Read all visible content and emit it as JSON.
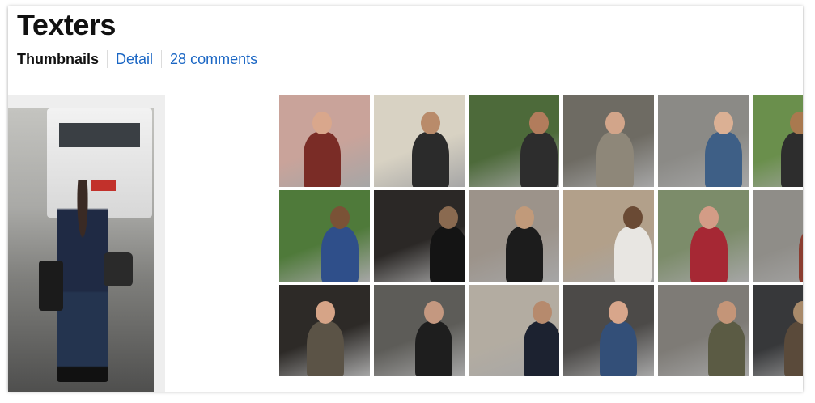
{
  "page": {
    "title": "Texters"
  },
  "tabs": [
    {
      "label": "Thumbnails",
      "active": true
    },
    {
      "label": "Detail",
      "active": false
    },
    {
      "label": "28 comments",
      "active": false
    }
  ],
  "colors": {
    "link": "#1a66c4",
    "sidebar_bg": "#eeeeee",
    "title": "#111111"
  },
  "featured_photo": {
    "subject": "woman-texting-on-sidewalk"
  },
  "thumbnails": [
    {
      "subject": "woman-red-hair-sunglasses",
      "bg": "#c9a39a",
      "accent": "#7a2c26",
      "skin": "#d9a78c"
    },
    {
      "subject": "man-sitting-on-beach",
      "bg": "#d8d2c3",
      "accent": "#2b2b2b",
      "skin": "#b98b6a"
    },
    {
      "subject": "man-in-suit-with-phone",
      "bg": "#4d6a3a",
      "accent": "#2d2d2d",
      "skin": "#b27c5c"
    },
    {
      "subject": "woman-near-food-cart",
      "bg": "#6e6b63",
      "accent": "#8e8779",
      "skin": "#d2a58a"
    },
    {
      "subject": "blonde-woman-on-street",
      "bg": "#8b8a86",
      "accent": "#3e5f86",
      "skin": "#dbb094"
    },
    {
      "subject": "man-at-park-cropped",
      "bg": "#6a8f4c",
      "accent": "#2d2d2d",
      "skin": "#a9794f"
    },
    {
      "subject": "man-under-lamppost-in-park",
      "bg": "#4f7a3a",
      "accent": "#2f4f8a",
      "skin": "#7a5236"
    },
    {
      "subject": "figure-in-dark-hallway",
      "bg": "#2b2826",
      "accent": "#141414",
      "skin": "#8a6a50"
    },
    {
      "subject": "man-sitting-on-chair",
      "bg": "#9c938a",
      "accent": "#1c1c1c",
      "skin": "#c19a7a"
    },
    {
      "subject": "man-with-hat-in-crowd",
      "bg": "#b2a08a",
      "accent": "#e8e6e2",
      "skin": "#6a4a34"
    },
    {
      "subject": "man-at-cafe-table",
      "bg": "#7c8c6a",
      "accent": "#a62834",
      "skin": "#d39c86"
    },
    {
      "subject": "man-in-red-shirt-cropped",
      "bg": "#8f8d88",
      "accent": "#8b3d30",
      "skin": "#c2906e"
    },
    {
      "subject": "man-looking-down-at-phone",
      "bg": "#2d2a27",
      "accent": "#5b5346",
      "skin": "#d6a487"
    },
    {
      "subject": "man-in-dark-jacket",
      "bg": "#5d5c58",
      "accent": "#1e1e1e",
      "skin": "#c49880"
    },
    {
      "subject": "man-against-stone-wall",
      "bg": "#b3aca1",
      "accent": "#1c2230",
      "skin": "#b68a6d"
    },
    {
      "subject": "red-haired-woman-plaid-shirt",
      "bg": "#4c4a48",
      "accent": "#334f78",
      "skin": "#d8a68b"
    },
    {
      "subject": "woman-on-city-sidewalk",
      "bg": "#7e7b76",
      "accent": "#5b5b44",
      "skin": "#c49578"
    },
    {
      "subject": "building-entrance-cropped",
      "bg": "#37383a",
      "accent": "#5a4a3a",
      "skin": "#a88a6a"
    }
  ]
}
